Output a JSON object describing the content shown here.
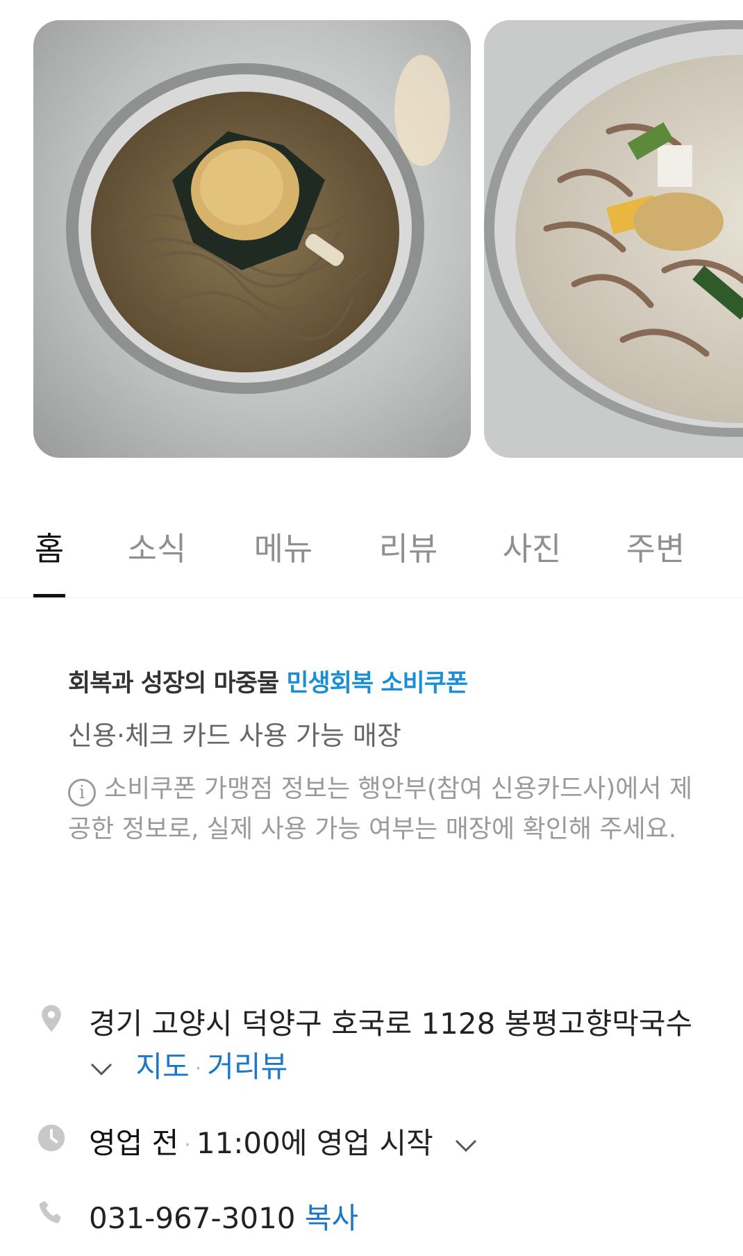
{
  "photos": [
    {
      "icon": "naengmyeon-photo"
    },
    {
      "icon": "kongguksu-photo"
    }
  ],
  "tabs": [
    {
      "label": "홈",
      "active": true
    },
    {
      "label": "소식"
    },
    {
      "label": "메뉴"
    },
    {
      "label": "리뷰"
    },
    {
      "label": "사진"
    },
    {
      "label": "주변"
    }
  ],
  "coupon": {
    "title_prefix": "회복과 성장의 마중물",
    "title_highlight": "민생회복 소비쿠폰",
    "subtitle": "신용·체크 카드 사용 가능 매장",
    "info_glyph": "i",
    "note": "소비쿠폰 가맹점 정보는 행안부(참여 신용카드사)에서 제공한 정보로, 실제 사용 가능 여부는 매장에 확인해 주세요."
  },
  "address": {
    "text": "경기 고양시 덕양구 호국로 1128 봉평고향막국수",
    "map_link": "지도",
    "street_view_link": "거리뷰",
    "separator": "·"
  },
  "hours": {
    "status": "영업 전",
    "separator": "·",
    "detail": "11:00에 영업 시작"
  },
  "phone": {
    "number": "031-967-3010",
    "copy_label": "복사"
  },
  "colors": {
    "accent_blue": "#1b8fd6",
    "link_blue": "#1b77c8",
    "icon_gray": "#c8c8c8"
  }
}
